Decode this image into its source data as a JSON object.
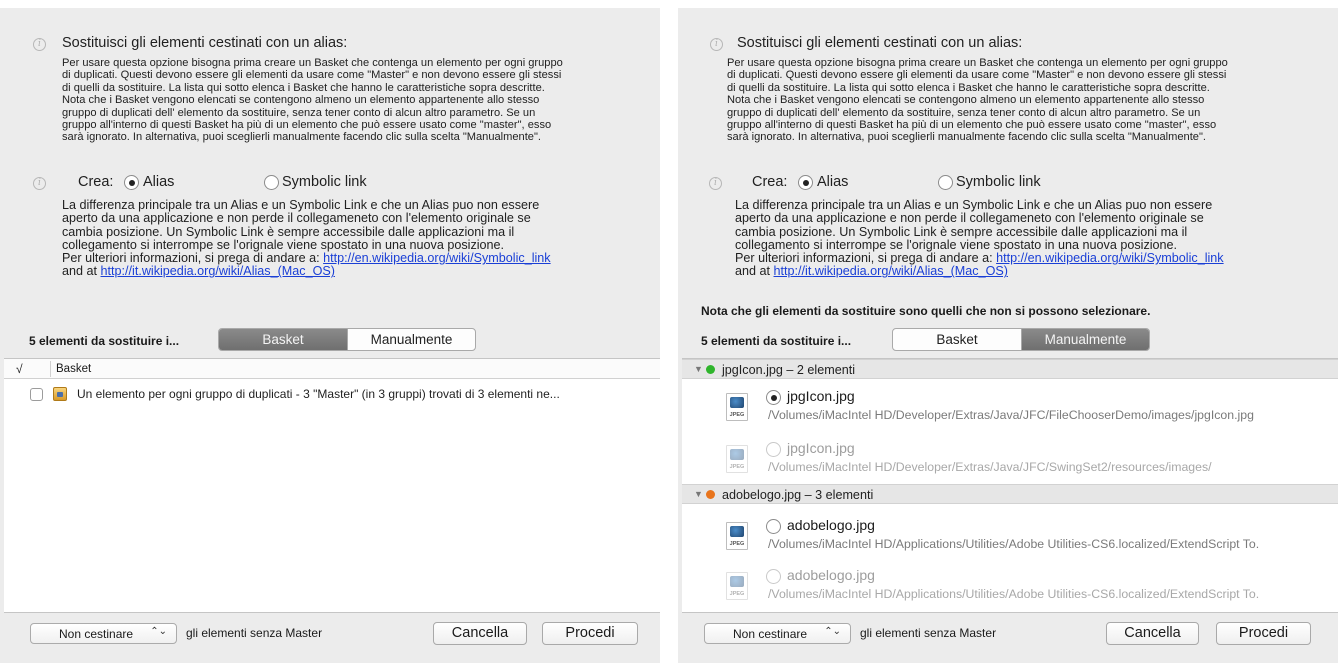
{
  "option": {
    "heading": "Sostituisci gli elementi cestinati con un alias:",
    "description_lines": [
      "Per usare questa opzione bisogna prima creare un Basket che contenga un elemento per ogni gruppo",
      "di duplicati. Questi devono essere gli elementi da usare come \"Master\" e non devono essere gli stessi",
      "di quelli da sostituire. La lista qui sotto elenca i Basket che hanno le caratteristiche sopra descritte.",
      "Nota che i Basket vengono elencati se contengono almeno un elemento appartenente allo stesso",
      "gruppo di duplicati dell' elemento da sostituire, senza tener conto di alcun altro parametro. Se un",
      "gruppo all'interno di questi Basket ha più di un elemento che può essere usato come \"master\", esso",
      "sarà ignorato. In alternativa, puoi sceglierli manualmente facendo clic sulla scelta \"Manualmente\"."
    ]
  },
  "create": {
    "label": "Crea:",
    "option_alias": "Alias",
    "option_symlink": "Symbolic link",
    "selected": "Alias",
    "explanation_lines": [
      "La differenza principale tra un Alias e un Symbolic Link e che un Alias puo non essere",
      "aperto da una applicazione e non perde il collegameneto con l'elemento originale se",
      "cambia posizione. Un Symbolic Link è sempre accessibile dalle applicazioni ma il",
      "collegamento si interrompe se l'orignale viene spostato in una nuova posizione."
    ],
    "info_prefix": "Per ulteriori informazioni, si prega di andare a: ",
    "link1": "http://en.wikipedia.org/wiki/Symbolic_link",
    "info_and": "and at ",
    "link2": "http://it.wikipedia.org/wiki/Alias_(Mac_OS)"
  },
  "note_unselectable": "Nota che gli elementi da sostituire sono quelli che non si possono selezionare.",
  "count_label": "5 elementi da sostituire i...",
  "segments": {
    "basket": "Basket",
    "manual": "Manualmente"
  },
  "basket_table": {
    "check_header": "√",
    "header": "Basket",
    "rows": [
      {
        "checked": false,
        "text": "Un elemento per ogni gruppo di duplicati - 3 \"Master\" (in 3 gruppi) trovati di 3 elementi ne..."
      }
    ]
  },
  "manual_list": {
    "groups": [
      {
        "label": "jpgIcon.jpg – 2 elementi",
        "color": "#2fb52c",
        "items": [
          {
            "name": "jpgIcon.jpg",
            "path": "/Volumes/iMacIntel HD/Developer/Extras/Java/JFC/FileChooserDemo/images/jpgIcon.jpg",
            "selected": true,
            "enabled": true,
            "icon": "jpeg-file-icon"
          },
          {
            "name": "jpgIcon.jpg",
            "path": "/Volumes/iMacIntel HD/Developer/Extras/Java/JFC/SwingSet2/resources/images/",
            "selected": false,
            "enabled": false,
            "icon": "jpeg-file-icon"
          }
        ]
      },
      {
        "label": "adobelogo.jpg – 3 elementi",
        "color": "#e8741c",
        "items": [
          {
            "name": "adobelogo.jpg",
            "path": "/Volumes/iMacIntel HD/Applications/Utilities/Adobe Utilities-CS6.localized/ExtendScript To.",
            "selected": false,
            "enabled": true,
            "icon": "jpeg-file-icon"
          },
          {
            "name": "adobelogo.jpg",
            "path": "/Volumes/iMacIntel HD/Applications/Utilities/Adobe Utilities-CS6.localized/ExtendScript To.",
            "selected": false,
            "enabled": false,
            "icon": "jpeg-file-icon"
          }
        ]
      }
    ]
  },
  "footer": {
    "popup_value": "Non cestinare",
    "popup_arrows": "⌃⌄",
    "trailing_text": "gli elementi senza Master",
    "cancel": "Cancella",
    "proceed": "Procedi"
  },
  "icons": {
    "info": "info-icon",
    "basket": "basket-icon",
    "file": "jpeg-file-icon",
    "jpeg_label": "JPEG"
  }
}
